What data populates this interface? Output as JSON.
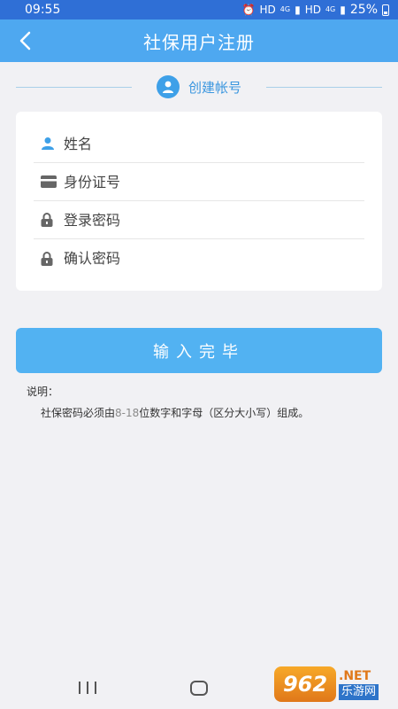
{
  "status_bar": {
    "time": "09:55",
    "indicators": [
      "alarm-icon",
      "HD",
      "4G",
      "HD",
      "4G"
    ],
    "hd_label": "HD",
    "net_label": "4G",
    "battery": "25%"
  },
  "header": {
    "title": "社保用户注册"
  },
  "section": {
    "label": "创建帐号"
  },
  "form": {
    "fields": [
      {
        "placeholder": "姓名",
        "icon": "user-icon"
      },
      {
        "placeholder": "身份证号",
        "icon": "id-card-icon"
      },
      {
        "placeholder": "登录密码",
        "icon": "lock-icon"
      },
      {
        "placeholder": "确认密码",
        "icon": "lock-icon"
      }
    ]
  },
  "submit": {
    "label": "输入完毕"
  },
  "notes": {
    "title": "说明：",
    "text_before": "社保密码必须由",
    "text_highlight": "8-18",
    "text_after": "位数字和字母（区分大小写）组成。"
  },
  "watermark": {
    "logo": "962",
    "net": ".NET",
    "site": "乐游网"
  },
  "colors": {
    "status_bar": "#2f6fd6",
    "header": "#4ea8f0",
    "accent": "#3ea0e8",
    "button": "#52b2f2",
    "background": "#f1f1f4"
  }
}
